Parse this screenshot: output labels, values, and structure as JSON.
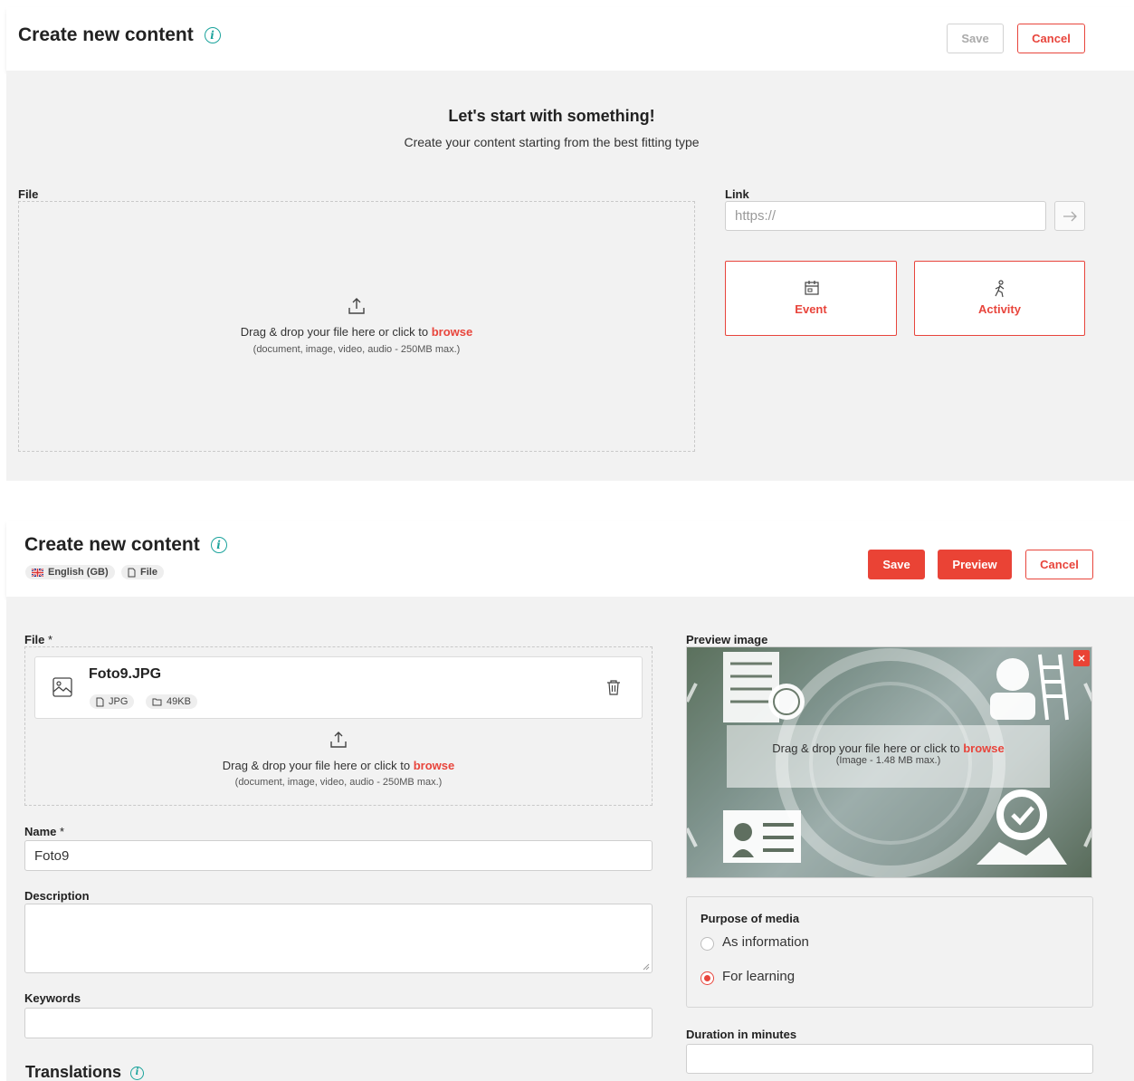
{
  "top": {
    "title": "Create new content",
    "save_label": "Save",
    "cancel_label": "Cancel",
    "heading": "Let's start with something!",
    "subheading": "Create your content starting from the best fitting type",
    "file_label": "File",
    "dropzone": {
      "text": "Drag & drop your file here or click to ",
      "browse": "browse",
      "hint": "(document, image, video, audio - 250MB max.)"
    },
    "link_label": "Link",
    "link_placeholder": "https://",
    "tiles": [
      {
        "label": "Event",
        "icon": "calendar-icon"
      },
      {
        "label": "Activity",
        "icon": "walking-person-icon"
      }
    ]
  },
  "bottom": {
    "title": "Create new content",
    "chips": [
      {
        "label": "English (GB)",
        "icon": "uk-flag-icon"
      },
      {
        "label": "File",
        "icon": "file-icon"
      }
    ],
    "save_label": "Save",
    "preview_label": "Preview",
    "cancel_label": "Cancel",
    "file_label": "File",
    "required_mark": "*",
    "file": {
      "name": "Foto9.JPG",
      "type": "JPG",
      "size": "49KB"
    },
    "dropzone": {
      "text": "Drag & drop your file here or click to ",
      "browse": "browse",
      "hint": "(document, image, video, audio - 250MB max.)"
    },
    "name_label": "Name",
    "name_value": "Foto9",
    "description_label": "Description",
    "keywords_label": "Keywords",
    "translations_label": "Translations",
    "preview_image_label": "Preview image",
    "preview_dropzone": {
      "text": "Drag & drop your file here or click to ",
      "browse": "browse",
      "hint": "(Image - 1.48 MB max.)"
    },
    "purpose_label": "Purpose of media",
    "purpose_options": [
      {
        "label": "As information",
        "checked": false
      },
      {
        "label": "For learning",
        "checked": true
      }
    ],
    "duration_label": "Duration in minutes"
  },
  "colors": {
    "accent": "#ea4335",
    "info": "#1ba39c",
    "panel_bg": "#f2f2f2"
  }
}
